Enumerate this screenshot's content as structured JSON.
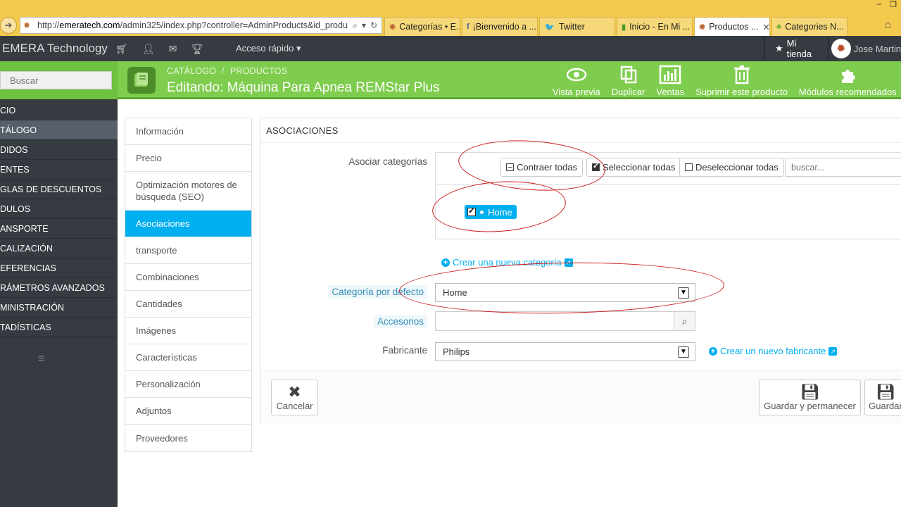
{
  "browser": {
    "url_prefix": "http://",
    "url_domain": "emeratech.com",
    "url_path": "/admin325/index.php?controller=AdminProducts&id_produ",
    "tabs": [
      {
        "label": "Categorías • E...",
        "icon": "✹",
        "color": "#c06a3a"
      },
      {
        "label": "¡Bienvenido a ...",
        "icon": "f",
        "color": "#3b5998"
      },
      {
        "label": "Twitter",
        "icon": "🐦",
        "color": "#1da1f2"
      },
      {
        "label": "Inicio - En Mi ...",
        "icon": "▮",
        "color": "#4c9a2a"
      },
      {
        "label": "Productos ...",
        "icon": "✹",
        "color": "#c06a3a",
        "active": true
      },
      {
        "label": "Categories N...",
        "icon": "♣",
        "color": "#6fa83a"
      }
    ]
  },
  "topbar": {
    "brand": "EMERA Technology",
    "quick_access": "Acceso rápido",
    "my_shop": "Mi tienda",
    "user": "Jose Martin"
  },
  "sidebar": {
    "search_placeholder": "Buscar",
    "items": [
      {
        "label": "CIO"
      },
      {
        "label": "TÁLOGO",
        "active": true
      },
      {
        "label": "DIDOS"
      },
      {
        "label": "ENTES"
      },
      {
        "label": "GLAS DE DESCUENTOS"
      },
      {
        "label": "DULOS"
      },
      {
        "label": "ANSPORTE"
      },
      {
        "label": "CALIZACIÓN"
      },
      {
        "label": "EFERENCIAS"
      },
      {
        "label": "RÁMETROS AVANZADOS"
      },
      {
        "label": "MINISTRACIÓN"
      },
      {
        "label": "TADÍSTICAS"
      }
    ]
  },
  "header": {
    "breadcrumb_1": "CATÁLOGO",
    "breadcrumb_sep": "/",
    "breadcrumb_2": "PRODUCTOS",
    "title": "Editando: Máquina Para Apnea REMStar Plus",
    "toolbar": {
      "preview": "Vista previa",
      "duplicate": "Duplicar",
      "sales": "Ventas",
      "delete": "Suprimir este producto",
      "modules": "Módulos recomendados",
      "more": "A"
    }
  },
  "product_tabs": [
    {
      "label": "Información"
    },
    {
      "label": "Precio"
    },
    {
      "label": "Optimización motores de búsqueda (SEO)",
      "tall": true
    },
    {
      "label": "Asociaciones",
      "active": true
    },
    {
      "label": "transporte"
    },
    {
      "label": "Combinaciones"
    },
    {
      "label": "Cantidades"
    },
    {
      "label": "Imágenes"
    },
    {
      "label": "Características"
    },
    {
      "label": "Personalización"
    },
    {
      "label": "Adjuntos"
    },
    {
      "label": "Proveedores"
    }
  ],
  "associations": {
    "title": "ASOCIACIONES",
    "assoc_label": "Asociar categorías",
    "collapse_all": "Contraer todas",
    "select_all": "Seleccionar todas",
    "deselect_all": "Deseleccionar todas",
    "cat_search_placeholder": "buscar...",
    "home_node": "Home",
    "new_category": "Crear una nueva categoría",
    "default_cat_label": "Categoría por defecto",
    "default_cat_value": "Home",
    "accessories_label": "Accesorios",
    "accessories_value": "",
    "manufacturer_label": "Fabricante",
    "manufacturer_value": "Philips",
    "new_manufacturer": "Crear un nuevo fabricante",
    "cancel": "Cancelar",
    "save_stay": "Guardar y permanecer",
    "save": "Guardar"
  }
}
